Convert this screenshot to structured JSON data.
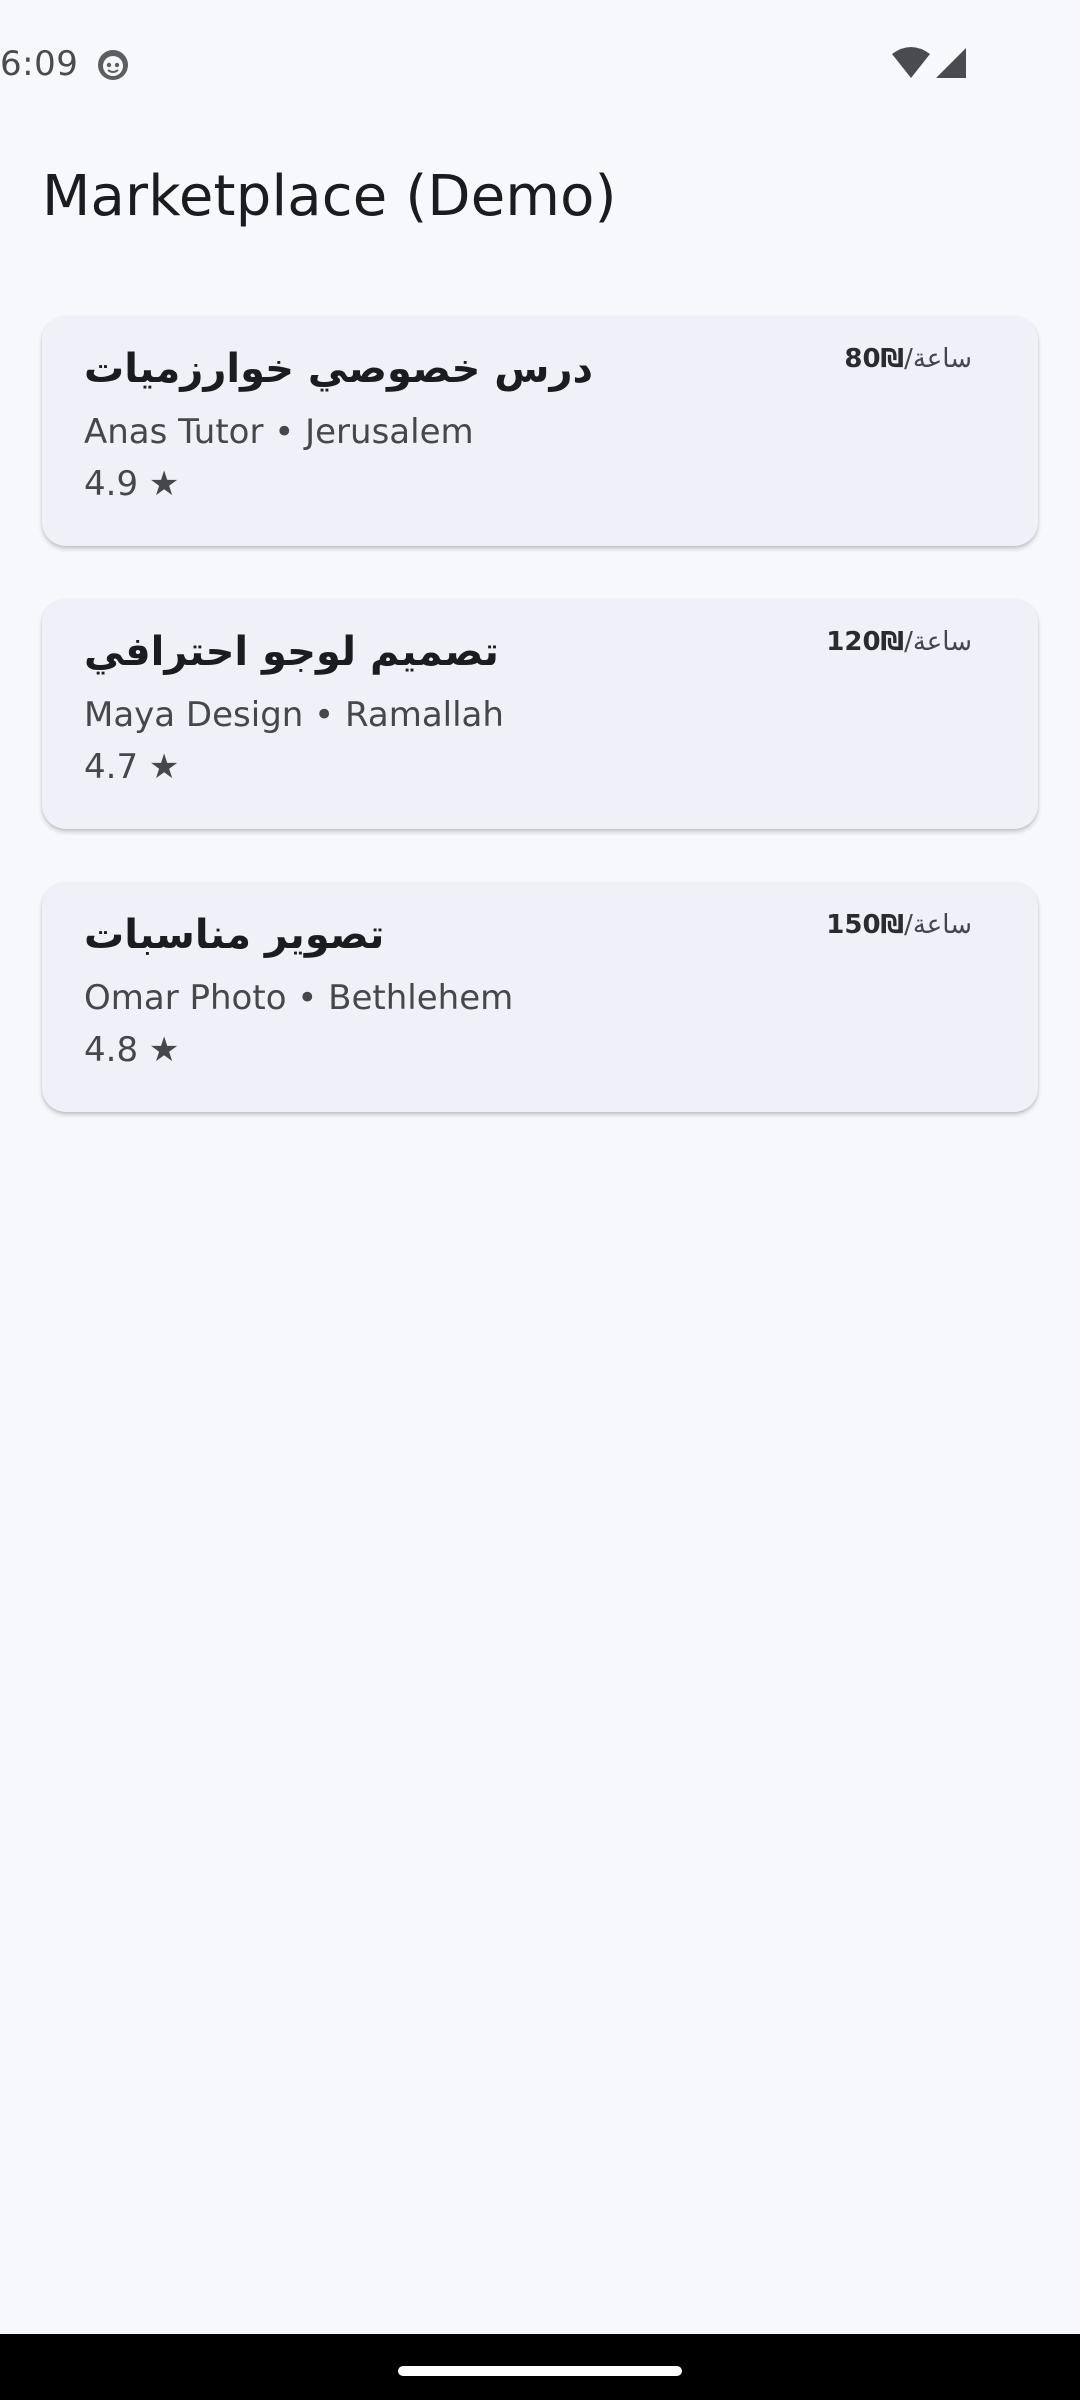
{
  "status_bar": {
    "time": "6:09",
    "icons": [
      "app-notification-icon",
      "wifi-icon",
      "cell-signal-icon"
    ]
  },
  "app_bar": {
    "title": "Marketplace (Demo)"
  },
  "listings": [
    {
      "title": "درس خصوصي خوارزميات",
      "price_amount": "80₪",
      "price_unit": "/ساعة",
      "meta": "Anas Tutor • Jerusalem",
      "rating": "4.9 ★"
    },
    {
      "title": "تصميم لوجو احترافي",
      "price_amount": "120₪",
      "price_unit": "/ساعة",
      "meta": "Maya Design • Ramallah",
      "rating": "4.7 ★"
    },
    {
      "title": "تصوير مناسبات",
      "price_amount": "150₪",
      "price_unit": "/ساعة",
      "meta": "Omar Photo • Bethlehem",
      "rating": "4.8 ★"
    }
  ],
  "colors": {
    "background": "#f7f8fc",
    "card": "#f0f1f8",
    "text_primary": "#1b1c20",
    "text_secondary": "#46474d",
    "nav_bar": "#000000"
  }
}
